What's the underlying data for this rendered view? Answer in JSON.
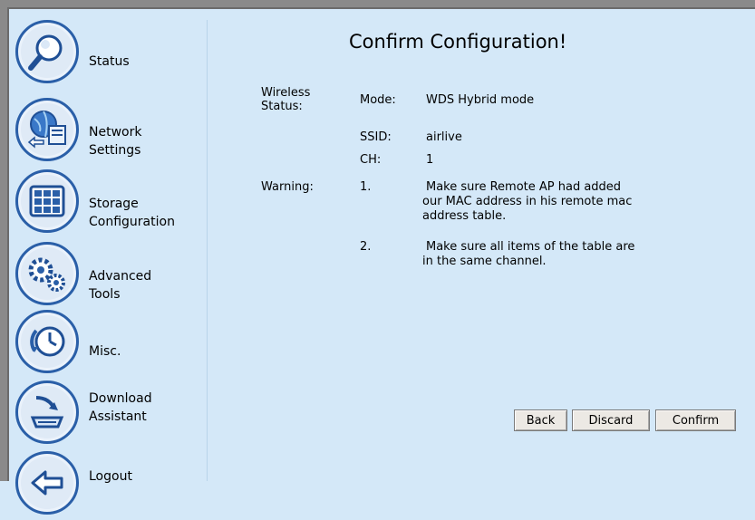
{
  "title": "Confirm Configuration!",
  "sidebar": {
    "items": [
      {
        "label": "Status",
        "icon": "magnifier-icon"
      },
      {
        "label": "Network Settings",
        "line1": "Network",
        "line2": "Settings",
        "icon": "network-globe-icon"
      },
      {
        "label": "Storage Configuration",
        "line1": "Storage",
        "line2": "Configuration",
        "icon": "storage-grid-icon"
      },
      {
        "label": "Advanced Tools",
        "line1": "Advanced",
        "line2": "Tools",
        "icon": "gears-icon"
      },
      {
        "label": "Misc.",
        "icon": "clock-icon"
      },
      {
        "label": "Download Assistant",
        "line1": "Download",
        "line2": "Assistant",
        "icon": "download-tray-icon"
      },
      {
        "label": "Logout",
        "icon": "back-arrow-icon"
      }
    ]
  },
  "wireless": {
    "label_line1": "Wireless",
    "label_line2": "Status:",
    "mode_label": "Mode:",
    "mode_value": "WDS Hybrid mode",
    "ssid_label": "SSID:",
    "ssid_value": "airlive",
    "ch_label": "CH:",
    "ch_value": "1"
  },
  "warning": {
    "label": "Warning:",
    "items": [
      {
        "num": "1.",
        "line1": "Make sure Remote AP had added",
        "line2": "our MAC address in his remote mac",
        "line3": "address table."
      },
      {
        "num": "2.",
        "line1": "Make sure all items of the table are",
        "line2": "in the same channel."
      }
    ]
  },
  "buttons": {
    "back": "Back",
    "discard": "Discard",
    "confirm": "Confirm"
  },
  "colors": {
    "background": "#d4e8f8",
    "icon_ring": "#2a5fa8",
    "frame": "#8a8a8a"
  }
}
